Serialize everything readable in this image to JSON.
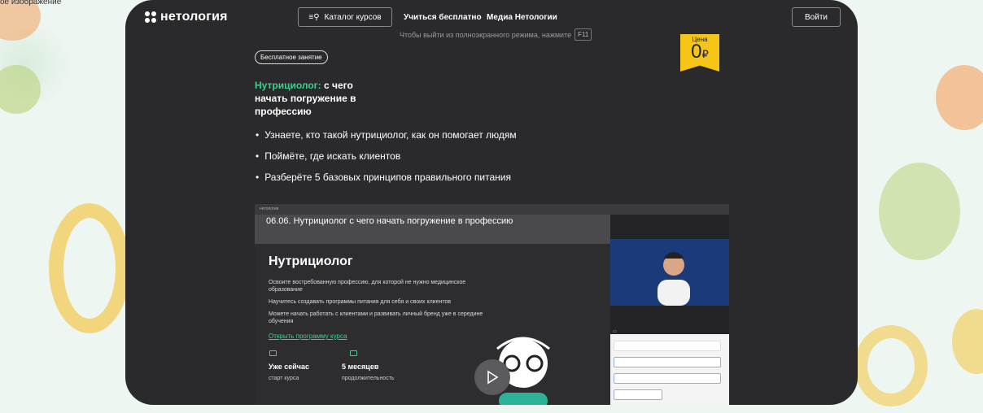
{
  "alt_text": "ое изображение",
  "nav": {
    "logo": "нетология",
    "catalog": "Каталог курсов",
    "free_learn": "Учиться бесплатно",
    "media": "Медиа Нетологии",
    "login": "Войти"
  },
  "fullscreen_hint": {
    "text": "Чтобы выйти из полноэкранного режима, нажмите",
    "key": "F11"
  },
  "price": {
    "label": "Цена",
    "value": "0",
    "currency": "₽"
  },
  "tag": "Бесплатное занятие",
  "title": {
    "accent": "Нутрициолог:",
    "rest": " с чего начать погружение в профессию"
  },
  "bullets": [
    "Узнаете, кто такой нутрициолог, как он помогает людям",
    "Поймёте, где искать клиентов",
    "Разберёте 5 базовых принципов правильного питания"
  ],
  "video": {
    "top_logo": "нетология",
    "title": "06.06. Нутрициолог с чего начать погружение в профессию",
    "slide_heading": "Нутрициолог",
    "slide_p1": "Освоите востребованную профессию, для которой не нужно медицинское образование",
    "slide_p2": "Научитесь создавать программы питания для себя и своих клиентов",
    "slide_p3": "Можете начать работать с клиентами и развивать личный бренд уже в середине обучения",
    "slide_link": "Открыть программу курса",
    "stat1_big": "Уже сейчас",
    "stat1_small": "старт курса",
    "stat2_big": "5 месяцев",
    "stat2_small": "продолжительность"
  },
  "colors": {
    "accent": "#3fd08c",
    "card": "#2a2a2c",
    "price": "#f5c518"
  }
}
